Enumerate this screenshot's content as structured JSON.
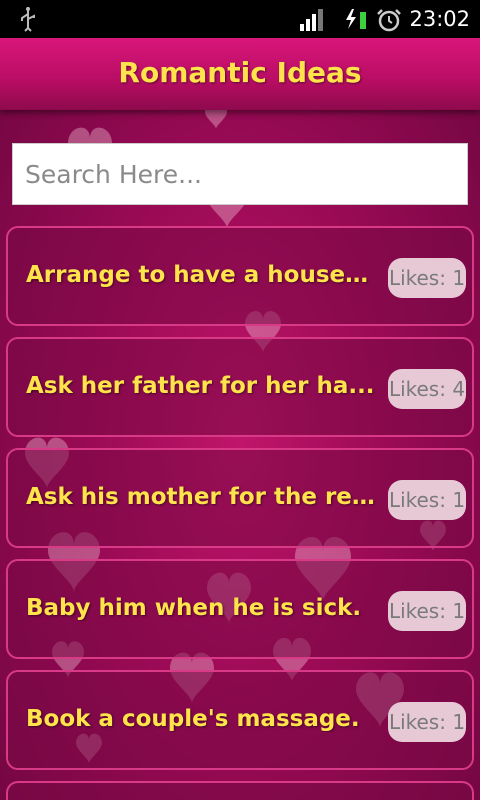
{
  "status_bar": {
    "time": "23:02"
  },
  "header": {
    "title": "Romantic Ideas"
  },
  "search": {
    "placeholder": "Search Here..."
  },
  "ideas": [
    {
      "text": "Arrange to have a house ...",
      "likes": "Likes: 1"
    },
    {
      "text": "Ask her father for her ha...",
      "likes": "Likes: 4"
    },
    {
      "text": "Ask his mother for the re...",
      "likes": "Likes: 1"
    },
    {
      "text": "Baby him when he is sick.",
      "likes": "Likes: 1"
    },
    {
      "text": "Book a couple's massage.",
      "likes": "Likes: 1"
    }
  ],
  "colors": {
    "title": "#ffe34a",
    "header": "#c8106d",
    "background": "#9a0a55"
  }
}
